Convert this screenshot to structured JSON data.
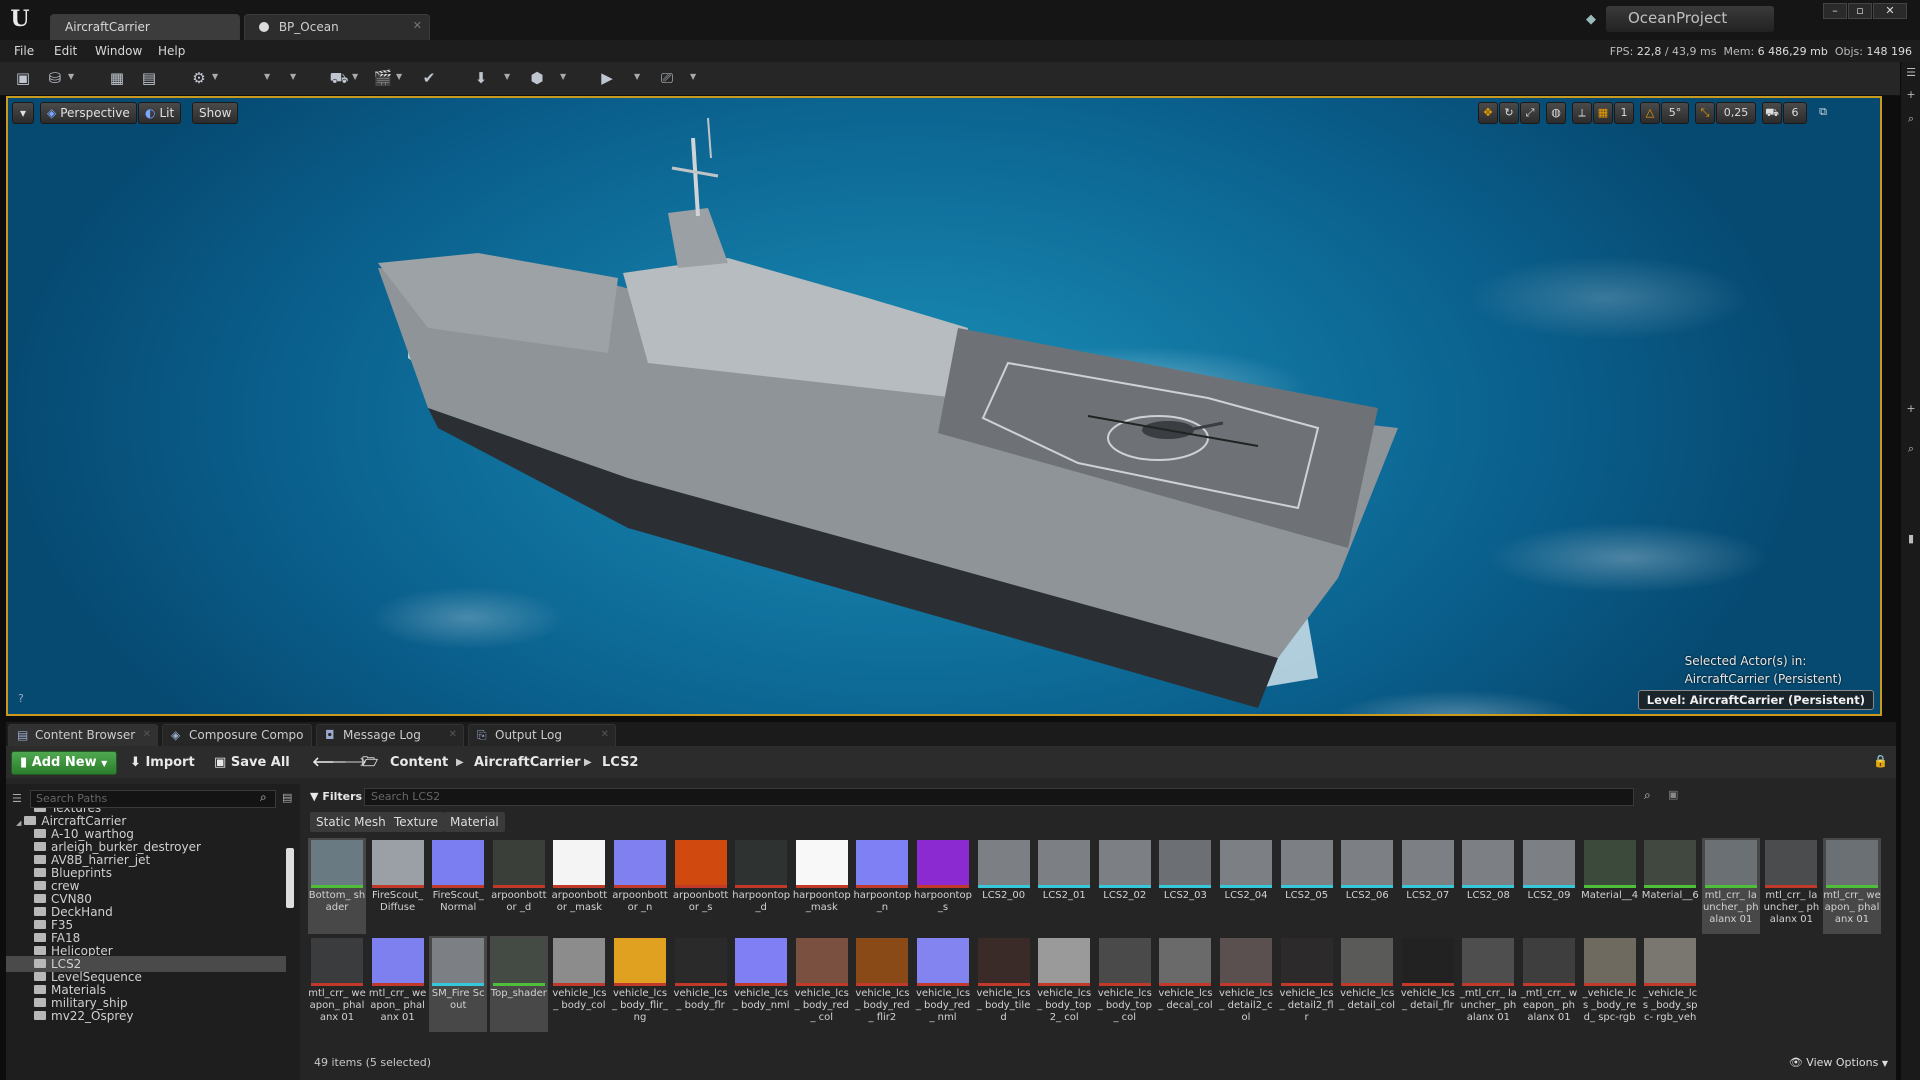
{
  "titlebar": {
    "tabs": [
      {
        "label": "AircraftCarrier"
      },
      {
        "label": "BP_Ocean"
      }
    ],
    "project": "OceanProject"
  },
  "menu": {
    "items": [
      "File",
      "Edit",
      "Window",
      "Help"
    ],
    "fps_label": "FPS:",
    "fps_value": "22,8",
    "ms_value": "/ 43,9 ms",
    "mem_label": "Mem:",
    "mem_value": "6 486,29 mb",
    "objs_label": "Objs:",
    "objs_value": "148 196"
  },
  "viewport": {
    "perspective": "Perspective",
    "lit": "Lit",
    "show": "Show",
    "snap_angle": "5°",
    "snap_scale": "0,25",
    "camera_speed": "6",
    "selected_line1": "Selected Actor(s) in:",
    "selected_line2": "AircraftCarrier (Persistent)",
    "level_label": "Level:  AircraftCarrier (Persistent)"
  },
  "panel_tabs": [
    {
      "label": "Content Browser"
    },
    {
      "label": "Composure Compo"
    },
    {
      "label": "Message Log"
    },
    {
      "label": "Output Log"
    }
  ],
  "content_browser": {
    "add_new": "Add New",
    "import": "Import",
    "save_all": "Save All",
    "breadcrumb": [
      "Content",
      "AircraftCarrier",
      "LCS2"
    ],
    "path_search_placeholder": "Search Paths",
    "filters": "Filters",
    "asset_search_placeholder": "Search LCS2",
    "filter_chips": [
      "Static Mesh",
      "Texture",
      "Material"
    ],
    "tree": [
      {
        "label": "Textures",
        "indent": 2
      },
      {
        "label": "AircraftCarrier",
        "indent": 1,
        "open": true
      },
      {
        "label": "A-10_warthog",
        "indent": 2
      },
      {
        "label": "arleigh_burker_destroyer",
        "indent": 2
      },
      {
        "label": "AV8B_harrier_jet",
        "indent": 2
      },
      {
        "label": "Blueprints",
        "indent": 2
      },
      {
        "label": "crew",
        "indent": 2
      },
      {
        "label": "CVN80",
        "indent": 2
      },
      {
        "label": "DeckHand",
        "indent": 2
      },
      {
        "label": "F35",
        "indent": 2
      },
      {
        "label": "FA18",
        "indent": 2
      },
      {
        "label": "Helicopter",
        "indent": 2
      },
      {
        "label": "LCS2",
        "indent": 2,
        "selected": true
      },
      {
        "label": "LevelSequence",
        "indent": 2
      },
      {
        "label": "Materials",
        "indent": 2
      },
      {
        "label": "military_ship",
        "indent": 2
      },
      {
        "label": "mv22_Osprey",
        "indent": 2
      }
    ],
    "assets_row1": [
      {
        "label": "Bottom_ shader",
        "kind": "mat",
        "color": "#6a7a82",
        "sel": true
      },
      {
        "label": "FireScout_ Diffuse",
        "kind": "tex",
        "color": "#9aa0a6"
      },
      {
        "label": "FireScout_ Normal",
        "kind": "tex",
        "color": "#7b7ef0"
      },
      {
        "label": "arpoonbottor _d",
        "kind": "tex",
        "color": "#3a3f3a"
      },
      {
        "label": "arpoonbottor _mask",
        "kind": "tex",
        "color": "#f4f4f4"
      },
      {
        "label": "arpoonbottor _n",
        "kind": "tex",
        "color": "#8080f0"
      },
      {
        "label": "arpoonbottor _s",
        "kind": "tex",
        "color": "#d04a10"
      },
      {
        "label": "harpoontop _d",
        "kind": "tex",
        "color": "#2e3230"
      },
      {
        "label": "harpoontop _mask",
        "kind": "tex",
        "color": "#f8f8f8"
      },
      {
        "label": "harpoontop _n",
        "kind": "tex",
        "color": "#7f80f4"
      },
      {
        "label": "harpoontop _s",
        "kind": "tex",
        "color": "#8a2ad0"
      },
      {
        "label": "LCS2_00",
        "kind": "mesh",
        "color": "#7c8084"
      },
      {
        "label": "LCS2_01",
        "kind": "mesh",
        "color": "#7c8084"
      },
      {
        "label": "LCS2_02",
        "kind": "mesh",
        "color": "#7c8084"
      },
      {
        "label": "LCS2_03",
        "kind": "mesh",
        "color": "#6c7074"
      },
      {
        "label": "LCS2_04",
        "kind": "mesh",
        "color": "#7c8084"
      },
      {
        "label": "LCS2_05",
        "kind": "mesh",
        "color": "#7c8084"
      },
      {
        "label": "LCS2_06",
        "kind": "mesh",
        "color": "#7c8084"
      },
      {
        "label": "LCS2_07",
        "kind": "mesh",
        "color": "#7c8084"
      },
      {
        "label": "LCS2_08",
        "kind": "mesh",
        "color": "#7c8084"
      },
      {
        "label": "LCS2_09",
        "kind": "mesh",
        "color": "#7c8084"
      },
      {
        "label": "Material__4",
        "kind": "mat",
        "color": "#3c4a3c"
      },
      {
        "label": "Material__6",
        "kind": "mat",
        "color": "#404840"
      },
      {
        "label": "mtl_crr_ launcher_ phalanx 01",
        "kind": "mat",
        "color": "#6a7074",
        "sel": true
      },
      {
        "label": "mtl_crr_ launcher_ phalanx 01",
        "kind": "tex",
        "color": "#4a4c4e"
      },
      {
        "label": "mtl_crr_ weapon_ phalanx 01",
        "kind": "mat",
        "color": "#6a7074",
        "sel": true
      }
    ],
    "assets_row2": [
      {
        "label": "mtl_crr_ weapon_ phalanx 01",
        "kind": "tex",
        "color": "#3a3c3e"
      },
      {
        "label": "mtl_crr_ weapon_ phalanx 01",
        "kind": "tex",
        "color": "#7f80f0"
      },
      {
        "label": "SM_Fire Scout",
        "kind": "mesh",
        "color": "#7c8084",
        "sel": true
      },
      {
        "label": "Top_shader",
        "kind": "mat",
        "color": "#444a44",
        "sel": true
      },
      {
        "label": "vehicle_lcs_ body_col",
        "kind": "tex",
        "color": "#8c8c8c"
      },
      {
        "label": "vehicle_lcs_ body_flir_ ng",
        "kind": "tex",
        "color": "#e0a020"
      },
      {
        "label": "vehicle_lcs_ body_flr",
        "kind": "tex",
        "color": "#2a2a2a"
      },
      {
        "label": "vehicle_lcs_ body_nml",
        "kind": "tex",
        "color": "#8080f4"
      },
      {
        "label": "vehicle_lcs_ body_red_ col",
        "kind": "tex",
        "color": "#7a5040"
      },
      {
        "label": "vehicle_lcs_ body_red_ flir2",
        "kind": "tex",
        "color": "#8a4a18"
      },
      {
        "label": "vehicle_lcs_ body_red_ nml",
        "kind": "tex",
        "color": "#8484f0"
      },
      {
        "label": "vehicle_lcs_ body_tiled",
        "kind": "tex",
        "color": "#3a2a28"
      },
      {
        "label": "vehicle_lcs_ body_top2_ col",
        "kind": "tex",
        "color": "#9a9a9a"
      },
      {
        "label": "vehicle_lcs_ body_top_ col",
        "kind": "tex",
        "color": "#4a4a4a"
      },
      {
        "label": "vehicle_lcs_ decal_col",
        "kind": "tex",
        "color": "#6a6a6a"
      },
      {
        "label": "vehicle_lcs_ detail2_col",
        "kind": "tex",
        "color": "#5a5050"
      },
      {
        "label": "vehicle_lcs_ detail2_flr",
        "kind": "tex",
        "color": "#2c2a2a"
      },
      {
        "label": "vehicle_lcs_ detail_col",
        "kind": "tex",
        "color": "#5a5a58"
      },
      {
        "label": "vehicle_lcs_ detail_flr",
        "kind": "tex",
        "color": "#222"
      },
      {
        "label": "_mtl_crr_ launcher_ phalanx 01",
        "kind": "tex",
        "color": "#4e4e4e"
      },
      {
        "label": "_mtl_crr_ weapon_ phalanx 01",
        "kind": "tex",
        "color": "#3e3e3e"
      },
      {
        "label": "_vehicle_lcs _body_red_ spc-rgb",
        "kind": "tex",
        "color": "#6e6a60"
      },
      {
        "label": "_vehicle_lcs _body_spc- rgb_veh",
        "kind": "tex",
        "color": "#7a7670"
      }
    ],
    "items_count": "49 items (5 selected)",
    "view_options": "View Options"
  },
  "colors": {
    "accent_orange": "#c89a1e",
    "add_new_green": "#3f9a3f",
    "ocean_blue": "#127fac"
  }
}
